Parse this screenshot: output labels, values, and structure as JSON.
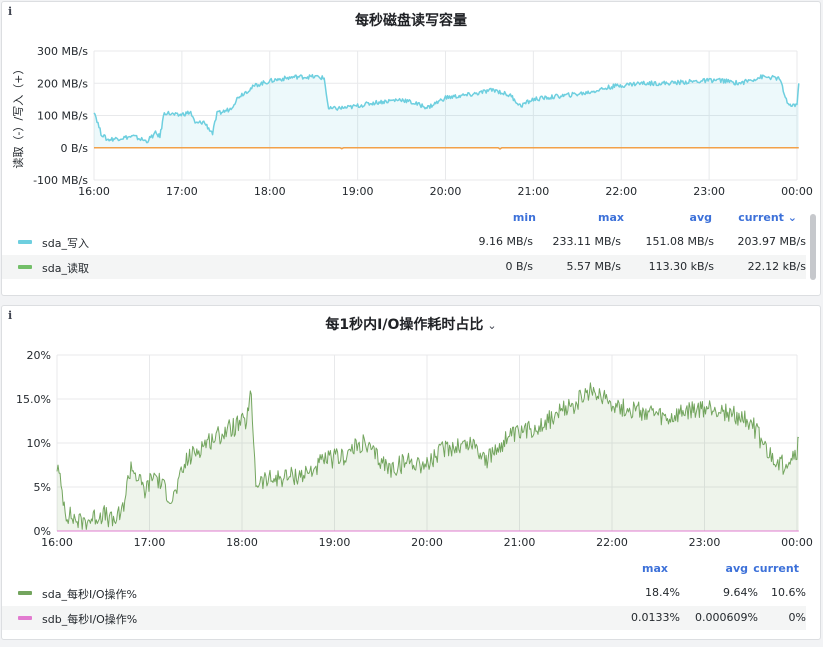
{
  "colors": {
    "sda_write": "#6ecfdf",
    "sda_read": "#73bf69",
    "line_orange": "#f2a14a",
    "io_sda": "#73a55e",
    "io_sdb": "#e27bd0",
    "accent": "#3d71d9"
  },
  "panel1": {
    "title": "每秒磁盘读写容量",
    "info": "i",
    "y_axis_label": "读取（-）/写入（+）",
    "legend_headers": {
      "min": "min",
      "max": "max",
      "avg": "avg",
      "current": "current ⌄"
    },
    "legend": [
      {
        "name": "sda_写入",
        "min": "9.16 MB/s",
        "max": "233.11 MB/s",
        "avg": "151.08 MB/s",
        "current": "203.97 MB/s"
      },
      {
        "name": "sda_读取",
        "min": "0 B/s",
        "max": "5.57 MB/s",
        "avg": "113.30 kB/s",
        "current": "22.12 kB/s"
      }
    ]
  },
  "panel2": {
    "title": "每1秒内I/O操作耗时占比",
    "title_chevron": "⌄",
    "info": "i",
    "legend_headers": {
      "max": "max",
      "avg": "avg",
      "current": "current"
    },
    "legend": [
      {
        "name": "sda_每秒I/O操作%",
        "max": "18.4%",
        "avg": "9.64%",
        "current": "10.6%"
      },
      {
        "name": "sdb_每秒I/O操作%",
        "max": "0.0133%",
        "avg": "0.000609%",
        "current": "0%"
      }
    ]
  },
  "chart_data": [
    {
      "type": "line",
      "title": "每秒磁盘读写容量",
      "ylabel": "读取（-）/写入（+）",
      "x_ticks": [
        "16:00",
        "17:00",
        "18:00",
        "19:00",
        "20:00",
        "21:00",
        "22:00",
        "23:00",
        "00:00"
      ],
      "y_ticks": [
        {
          "v": 300,
          "label": "300 MB/s"
        },
        {
          "v": 200,
          "label": "200 MB/s"
        },
        {
          "v": 100,
          "label": "100 MB/s"
        },
        {
          "v": 0,
          "label": "0 B/s"
        },
        {
          "v": -100,
          "label": "-100 MB/s"
        }
      ],
      "ylim": [
        -100,
        300
      ],
      "x_range_hours": [
        0,
        8
      ],
      "grid": true,
      "legend_position": "bottom",
      "series": [
        {
          "name": "sda_写入",
          "color": "#6ecfdf",
          "fill": true,
          "points": [
            [
              0,
              115
            ],
            [
              0.08,
              45
            ],
            [
              0.15,
              25
            ],
            [
              0.3,
              30
            ],
            [
              0.45,
              35
            ],
            [
              0.6,
              20
            ],
            [
              0.7,
              45
            ],
            [
              0.75,
              35
            ],
            [
              0.8,
              110
            ],
            [
              0.95,
              100
            ],
            [
              1.1,
              110
            ],
            [
              1.15,
              75
            ],
            [
              1.25,
              80
            ],
            [
              1.35,
              45
            ],
            [
              1.4,
              105
            ],
            [
              1.55,
              120
            ],
            [
              1.65,
              160
            ],
            [
              1.85,
              195
            ],
            [
              2.05,
              210
            ],
            [
              2.3,
              220
            ],
            [
              2.55,
              220
            ],
            [
              2.62,
              215
            ],
            [
              2.67,
              120
            ],
            [
              2.9,
              125
            ],
            [
              3.2,
              140
            ],
            [
              3.5,
              150
            ],
            [
              3.8,
              125
            ],
            [
              4.0,
              155
            ],
            [
              4.3,
              165
            ],
            [
              4.55,
              180
            ],
            [
              4.75,
              160
            ],
            [
              4.85,
              130
            ],
            [
              5.0,
              150
            ],
            [
              5.3,
              160
            ],
            [
              5.6,
              170
            ],
            [
              5.9,
              190
            ],
            [
              6.2,
              200
            ],
            [
              6.5,
              200
            ],
            [
              6.8,
              205
            ],
            [
              7.1,
              210
            ],
            [
              7.35,
              200
            ],
            [
              7.6,
              220
            ],
            [
              7.8,
              215
            ],
            [
              7.9,
              130
            ],
            [
              8.0,
              135
            ],
            [
              8.02,
              200
            ]
          ]
        },
        {
          "name": "sda_读取",
          "color": "#73bf69",
          "fill": false,
          "points": [
            [
              0,
              0
            ],
            [
              2.8,
              0
            ],
            [
              2.82,
              -3
            ],
            [
              2.84,
              0
            ],
            [
              4.6,
              0
            ],
            [
              4.62,
              -4
            ],
            [
              4.64,
              0
            ],
            [
              8.02,
              0
            ]
          ]
        }
      ]
    },
    {
      "type": "line",
      "title": "每1秒内I/O操作耗时占比",
      "x_ticks": [
        "16:00",
        "17:00",
        "18:00",
        "19:00",
        "20:00",
        "21:00",
        "22:00",
        "23:00",
        "00:00"
      ],
      "y_ticks": [
        {
          "v": 20,
          "label": "20%"
        },
        {
          "v": 15,
          "label": "15.0%"
        },
        {
          "v": 10,
          "label": "10%"
        },
        {
          "v": 5,
          "label": "5%"
        },
        {
          "v": 0,
          "label": "0%"
        }
      ],
      "ylim": [
        0,
        20
      ],
      "x_range_hours": [
        0,
        8
      ],
      "grid": true,
      "legend_position": "bottom",
      "series": [
        {
          "name": "sda_每秒I/O操作%",
          "color": "#73a55e",
          "fill": true,
          "points": [
            [
              0,
              7.5
            ],
            [
              0.1,
              2.0
            ],
            [
              0.25,
              1.0
            ],
            [
              0.35,
              1.3
            ],
            [
              0.5,
              2.0
            ],
            [
              0.6,
              1.0
            ],
            [
              0.7,
              2.0
            ],
            [
              0.8,
              7.5
            ],
            [
              0.95,
              4.5
            ],
            [
              1.05,
              6.5
            ],
            [
              1.15,
              5.0
            ],
            [
              1.25,
              3.5
            ],
            [
              1.4,
              8.0
            ],
            [
              1.6,
              10.0
            ],
            [
              1.85,
              11.5
            ],
            [
              2.05,
              12.5
            ],
            [
              2.1,
              15.5
            ],
            [
              2.15,
              5.5
            ],
            [
              2.4,
              6.0
            ],
            [
              2.7,
              6.5
            ],
            [
              2.9,
              8.0
            ],
            [
              3.1,
              8.5
            ],
            [
              3.3,
              10.0
            ],
            [
              3.45,
              8.5
            ],
            [
              3.6,
              7.0
            ],
            [
              3.8,
              8.0
            ],
            [
              4.0,
              7.5
            ],
            [
              4.2,
              9.5
            ],
            [
              4.5,
              10.0
            ],
            [
              4.65,
              8.0
            ],
            [
              4.85,
              10.5
            ],
            [
              5.0,
              11.0
            ],
            [
              5.3,
              12.5
            ],
            [
              5.6,
              14.5
            ],
            [
              5.8,
              16.0
            ],
            [
              5.95,
              15.0
            ],
            [
              6.1,
              14.0
            ],
            [
              6.4,
              13.5
            ],
            [
              6.6,
              12.5
            ],
            [
              6.8,
              13.5
            ],
            [
              7.1,
              14.0
            ],
            [
              7.35,
              13.0
            ],
            [
              7.5,
              12.5
            ],
            [
              7.7,
              8.5
            ],
            [
              7.85,
              7.5
            ],
            [
              8.0,
              9.0
            ],
            [
              8.02,
              10.6
            ]
          ]
        },
        {
          "name": "sdb_每秒I/O操作%",
          "color": "#e27bd0",
          "fill": false,
          "points": [
            [
              0,
              0
            ],
            [
              8.02,
              0
            ]
          ]
        }
      ]
    }
  ]
}
